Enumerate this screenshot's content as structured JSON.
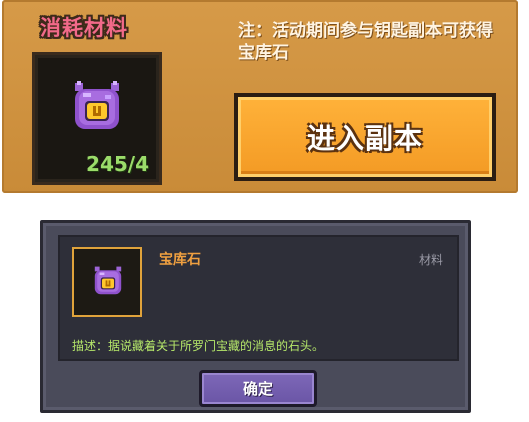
{
  "top_panel": {
    "title": "消耗材料",
    "item": {
      "icon": "treasure-stone-icon",
      "count": "245/4"
    },
    "note": "注：活动期间参与钥匙副本可获得宝库石",
    "enter_button_label": "进入副本"
  },
  "dialog": {
    "item_icon": "treasure-stone-icon",
    "item_name": "宝库石",
    "category": "材料",
    "description": "描述：据说藏着关于所罗门宝藏的消息的石头。",
    "confirm_label": "确定"
  },
  "colors": {
    "panel_orange": "#d69a48",
    "button_orange": "#f39a24",
    "dialog_bg": "#4a4b5a",
    "name_orange": "#f0a040",
    "desc_green": "#b6e86a",
    "count_green": "#9bdc6a",
    "confirm_purple": "#6a55a6",
    "title_pink": "#f26a8a"
  }
}
